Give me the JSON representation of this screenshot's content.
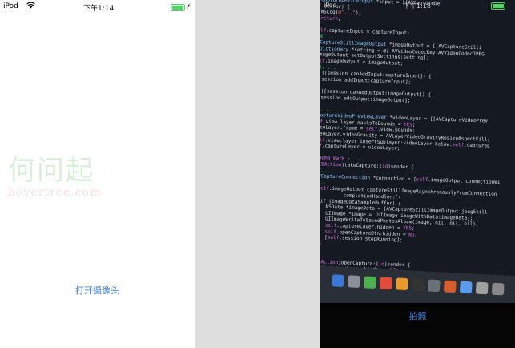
{
  "left": {
    "status": {
      "carrier": "iPod",
      "time": "下午1:14"
    },
    "watermark": {
      "title": "何问起",
      "subtitle": "hovertree.com"
    },
    "open_camera_label": "打开摄像头"
  },
  "right": {
    "status": {
      "carrier": "iPod",
      "time": "下午1:18"
    },
    "take_photo_label": "拍照"
  },
  "colors": {
    "accent_blue": "#3a7ee6",
    "battery_green": "#4cd964",
    "code_bg": "#151a22"
  }
}
